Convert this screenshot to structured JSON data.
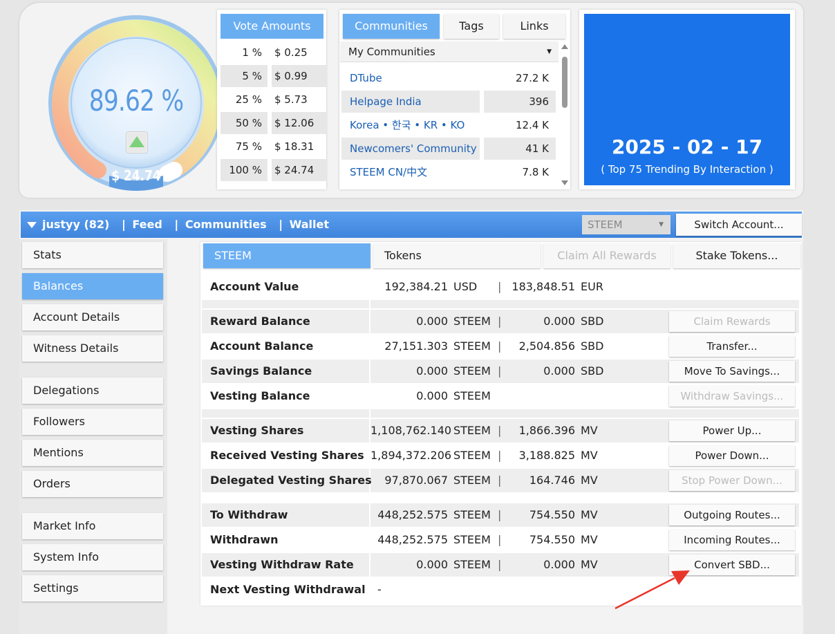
{
  "gauge": {
    "percent": "89.62 %",
    "value": "$ 24.74"
  },
  "vote_amounts": {
    "title": "Vote Amounts",
    "rows": [
      {
        "pct": "1 %",
        "usd": "$ 0.25"
      },
      {
        "pct": "5 %",
        "usd": "$ 0.99"
      },
      {
        "pct": "25 %",
        "usd": "$ 5.73"
      },
      {
        "pct": "50 %",
        "usd": "$ 12.06"
      },
      {
        "pct": "75 %",
        "usd": "$ 18.31"
      },
      {
        "pct": "100 %",
        "usd": "$ 24.74"
      }
    ]
  },
  "communities": {
    "tabs": [
      "Communities",
      "Tags",
      "Links"
    ],
    "selected": "My Communities",
    "rows": [
      {
        "name": "DTube",
        "count": "27.2 K"
      },
      {
        "name": "Helpage India",
        "count": "396"
      },
      {
        "name": "Korea • 한국 • KR • KO",
        "count": "12.4 K"
      },
      {
        "name": "Newcomers' Community",
        "count": "41 K"
      },
      {
        "name": "STEEM CN/中文",
        "count": "7.8 K"
      }
    ]
  },
  "date_box": {
    "date": "2025 - 02 - 17",
    "subtitle": "( Top 75 Trending By Interaction )"
  },
  "navbar": {
    "user": "justyy (82)",
    "links": [
      "Feed",
      "Communities",
      "Wallet"
    ],
    "separator": "|",
    "account_select": "STEEM",
    "switch_label": "Switch Account..."
  },
  "sidebar": {
    "items": [
      "Stats",
      "Balances",
      "Account Details",
      "Witness Details",
      "Delegations",
      "Followers",
      "Mentions",
      "Orders",
      "Market Info",
      "System Info",
      "Settings"
    ]
  },
  "content_tabs": {
    "steem": "STEEM",
    "tokens": "Tokens",
    "claim_all": "Claim All Rewards",
    "stake": "Stake Tokens..."
  },
  "account_value": {
    "label": "Account Value",
    "v1": "192,384.21",
    "u1": "USD",
    "v2": "183,848.51",
    "u2": "EUR"
  },
  "balances": {
    "reward": {
      "label": "Reward Balance",
      "v1": "0.000",
      "u1": "STEEM",
      "v2": "0.000",
      "u2": "SBD",
      "btn": "Claim Rewards"
    },
    "account": {
      "label": "Account Balance",
      "v1": "27,151.303",
      "u1": "STEEM",
      "v2": "2,504.856",
      "u2": "SBD",
      "btn": "Transfer..."
    },
    "savings": {
      "label": "Savings Balance",
      "v1": "0.000",
      "u1": "STEEM",
      "v2": "0.000",
      "u2": "SBD",
      "btn": "Move To Savings..."
    },
    "vesting": {
      "label": "Vesting Balance",
      "v1": "0.000",
      "u1": "STEEM",
      "btn": "Withdraw Savings..."
    }
  },
  "shares": {
    "vesting": {
      "label": "Vesting Shares",
      "v1": "1,108,762.140",
      "u1": "STEEM",
      "v2": "1,866.396",
      "u2": "MV",
      "btn": "Power Up..."
    },
    "received": {
      "label": "Received Vesting Shares",
      "v1": "1,894,372.206",
      "u1": "STEEM",
      "v2": "3,188.825",
      "u2": "MV",
      "btn": "Power Down..."
    },
    "delegated": {
      "label": "Delegated Vesting Shares",
      "v1": "97,870.067",
      "u1": "STEEM",
      "v2": "164.746",
      "u2": "MV",
      "btn": "Stop Power Down..."
    }
  },
  "withdraw": {
    "to": {
      "label": "To Withdraw",
      "v1": "448,252.575",
      "u1": "STEEM",
      "v2": "754.550",
      "u2": "MV",
      "btn": "Outgoing Routes..."
    },
    "withdrawn": {
      "label": "Withdrawn",
      "v1": "448,252.575",
      "u1": "STEEM",
      "v2": "754.550",
      "u2": "MV",
      "btn": "Incoming Routes..."
    },
    "rate": {
      "label": "Vesting Withdraw Rate",
      "v1": "0.000",
      "u1": "STEEM",
      "v2": "0.000",
      "u2": "MV",
      "btn": "Convert SBD..."
    },
    "next": {
      "label": "Next Vesting Withdrawal",
      "v1": "-"
    }
  },
  "colors": {
    "accent": "#6aaef2",
    "date_bg": "#1a73e8",
    "arrow": "#e8352b"
  }
}
